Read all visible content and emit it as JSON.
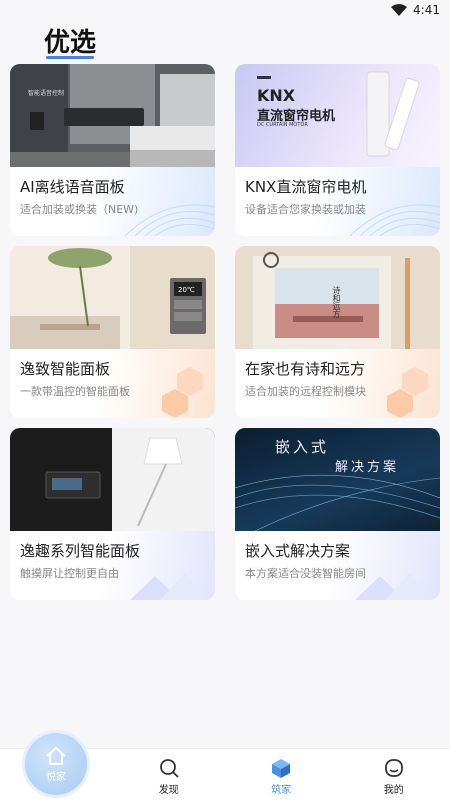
{
  "status": {
    "time": "4:41"
  },
  "page": {
    "title": "优选"
  },
  "cards": [
    {
      "title": "AI离线语音面板",
      "subtitle": "适合加装或换装（NEW)",
      "style": "blue",
      "img_caption": "智能语音控制"
    },
    {
      "title": "KNX直流窗帘电机",
      "subtitle": "设备适合您家换装或加装",
      "style": "blue",
      "img_caption": "KNX",
      "img_caption2": "直流窗帘电机",
      "img_caption3": "DC CURTAIN MOTOR"
    },
    {
      "title": "逸致智能面板",
      "subtitle": "一款带温控的智能面板",
      "style": "orange",
      "img_caption": "20℃"
    },
    {
      "title": "在家也有诗和远方",
      "subtitle": "适合加装的远程控制模块",
      "style": "orange",
      "img_caption": "诗和远方"
    },
    {
      "title": "逸趣系列智能面板",
      "subtitle": "触摸屏让控制更自由",
      "style": "purple"
    },
    {
      "title": "嵌入式解决方案",
      "subtitle": "本方案适合没装智能房间",
      "style": "purple",
      "img_caption": "嵌入式",
      "img_caption2": "解决方案"
    }
  ],
  "nav": [
    {
      "label": "悦家",
      "icon": "home-icon",
      "active": true
    },
    {
      "label": "发现",
      "icon": "discover-icon"
    },
    {
      "label": "筑家",
      "icon": "cube-icon"
    },
    {
      "label": "我的",
      "icon": "profile-icon"
    }
  ],
  "colors": {
    "accent": "#4a8fe0",
    "underline": "#4a7fd6"
  }
}
